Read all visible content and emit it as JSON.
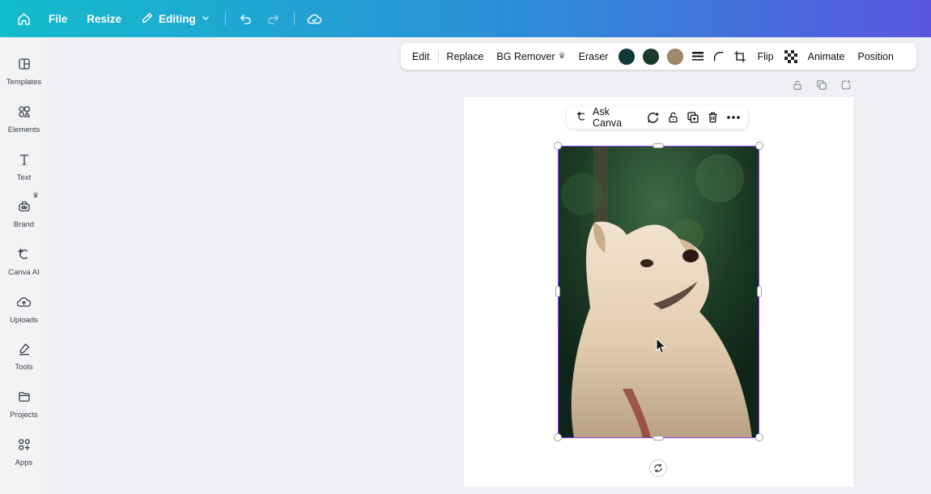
{
  "topbar": {
    "file_label": "File",
    "resize_label": "Resize",
    "editing_label": "Editing",
    "icons": [
      "home-icon",
      "pencil-icon",
      "chevron-down-icon",
      "undo-icon",
      "redo-icon",
      "cloud-save-icon"
    ]
  },
  "sidebar": {
    "items": [
      {
        "label": "Templates",
        "icon": "templates-icon"
      },
      {
        "label": "Elements",
        "icon": "elements-icon"
      },
      {
        "label": "Text",
        "icon": "text-icon"
      },
      {
        "label": "Brand",
        "icon": "brand-icon"
      },
      {
        "label": "Canva AI",
        "icon": "canva-ai-icon"
      },
      {
        "label": "Uploads",
        "icon": "uploads-icon"
      },
      {
        "label": "Tools",
        "icon": "tools-icon"
      },
      {
        "label": "Projects",
        "icon": "projects-icon"
      },
      {
        "label": "Apps",
        "icon": "apps-icon"
      }
    ]
  },
  "image_toolbar": {
    "edit_label": "Edit",
    "replace_label": "Replace",
    "bg_remover_label": "BG Remover",
    "eraser_label": "Eraser",
    "flip_label": "Flip",
    "animate_label": "Animate",
    "position_label": "Position",
    "swatch_colors": [
      "#0f3b36",
      "#1d3a2c",
      "#a3876b"
    ]
  },
  "element_toolbar": {
    "ask_canva_label": "Ask Canva"
  },
  "colors": {
    "selection": "#8b3dff",
    "topbar_start": "#13bccc",
    "topbar_end": "#5a55e0"
  }
}
